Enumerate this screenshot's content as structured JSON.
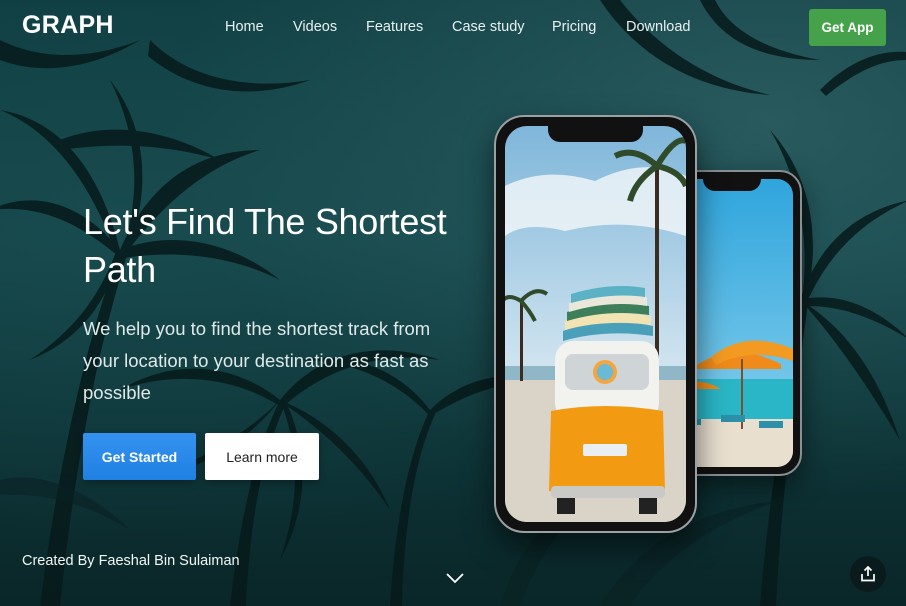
{
  "brand": {
    "logo": "GRAPH"
  },
  "nav": {
    "items": [
      {
        "label": "Home"
      },
      {
        "label": "Videos"
      },
      {
        "label": "Features"
      },
      {
        "label": "Case study"
      },
      {
        "label": "Pricing"
      },
      {
        "label": "Download"
      }
    ],
    "cta_label": "Get App"
  },
  "hero": {
    "title": "Let's Find The Shortest Path",
    "subtitle": "We help you to find the shortest track from your location to your destination as fast as possible",
    "primary_label": "Get Started",
    "secondary_label": "Learn more"
  },
  "footer": {
    "credit": "Created By Faeshal Bin Sulaiman"
  },
  "icons": {
    "scroll": "chevron-down-icon",
    "share": "share-icon"
  },
  "colors": {
    "background": "#0e3d40",
    "primary_button": "#2286ea",
    "get_app_button": "#45a24a",
    "secondary_button": "#ffffff"
  }
}
